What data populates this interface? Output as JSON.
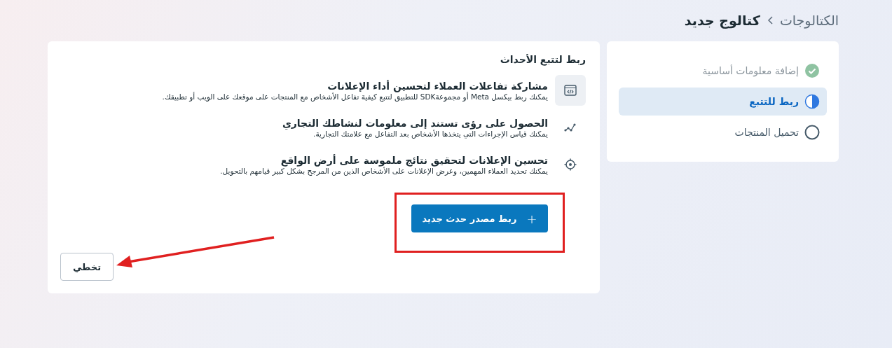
{
  "breadcrumb": [
    {
      "label": "الكتالوجات",
      "current": false
    },
    {
      "label": "كتالوج جديد",
      "current": true
    }
  ],
  "steps": [
    {
      "label": "إضافة معلومات أساسية",
      "kind": "done",
      "selected": false
    },
    {
      "label": "ربط للتتبع",
      "kind": "current",
      "selected": true
    },
    {
      "label": "تحميل المنتجات",
      "kind": "todo",
      "selected": false
    }
  ],
  "panel": {
    "title": "ربط لتتبع الأحداث",
    "features": [
      {
        "title": "مشاركة تفاعلات العملاء لتحسين أداء الإعلانات",
        "description": "يمكنك ربط بيكسل Meta أو مجموعةSDK للتطبيق لتتبع كيفية تفاعل الأشخاص مع المنتجات على موقعك على الويب أو تطبيقك.",
        "selected": true
      },
      {
        "title": "الحصول على رؤى تستند إلى معلومات لنشاطك التجاري",
        "description": "يمكنك قياس الإجراءات التي يتخذها الأشخاص بعد التفاعل مع علامتك التجارية.",
        "selected": false
      },
      {
        "title": "تحسين الإعلانات لتحقيق نتائج ملموسة على أرض الواقع",
        "description": "يمكنك تحديد العملاء المهمين، وعرض الإعلانات على الأشخاص الذين من المرجح بشكل كبير قيامهم بالتحويل.",
        "selected": false
      }
    ],
    "primary_button": {
      "label": "ربط مصدر حدث جديد",
      "icon": "+"
    },
    "skip_button": {
      "label": "تخطي"
    }
  },
  "annotations": [
    {
      "kind": "box"
    },
    {
      "kind": "arrow"
    }
  ]
}
